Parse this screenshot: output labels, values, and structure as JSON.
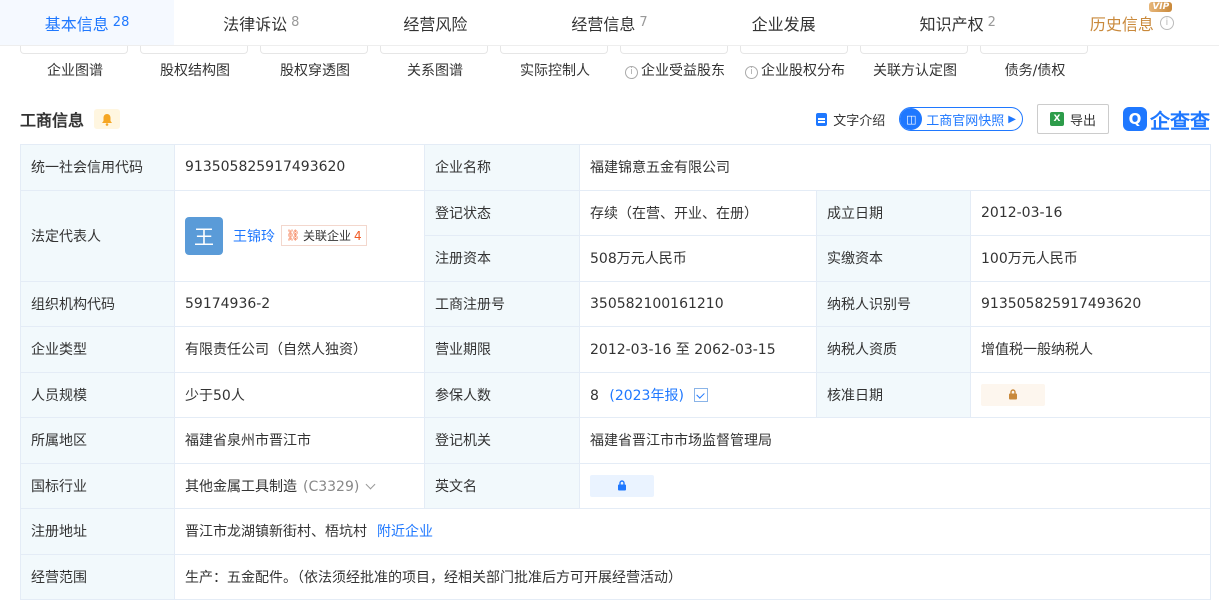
{
  "tabs": [
    {
      "label": "基本信息",
      "count": "28"
    },
    {
      "label": "法律诉讼",
      "count": "8"
    },
    {
      "label": "经营风险",
      "count": ""
    },
    {
      "label": "经营信息",
      "count": "7"
    },
    {
      "label": "企业发展",
      "count": ""
    },
    {
      "label": "知识产权",
      "count": "2"
    },
    {
      "label": "历史信息",
      "count": "",
      "badge": "VIP"
    }
  ],
  "graphs": [
    "企业图谱",
    "股权结构图",
    "股权穿透图",
    "关系图谱",
    "实际控制人",
    "企业受益股东",
    "企业股权分布",
    "关联方认定图",
    "债务/债权"
  ],
  "section": {
    "title": "工商信息",
    "text_intro": "文字介绍",
    "official_snapshot": "工商官网快照",
    "export": "导出",
    "logo": "企查查"
  },
  "colors": {
    "accent": "#1f78ff",
    "label_bg": "#f2f9fc",
    "border": "#e4ecf6",
    "history": "#c9893b"
  },
  "info": {
    "credit_code_label": "统一社会信用代码",
    "credit_code": "913505825917493620",
    "company_name_label": "企业名称",
    "company_name": "福建锦意五金有限公司",
    "legal_rep_label": "法定代表人",
    "legal_rep_avatar": "王",
    "legal_rep_name": "王锦玲",
    "related_label": "关联企业",
    "related_count": "4",
    "reg_status_label": "登记状态",
    "reg_status": "存续（在营、开业、在册）",
    "found_date_label": "成立日期",
    "found_date": "2012-03-16",
    "reg_capital_label": "注册资本",
    "reg_capital": "508万元人民币",
    "paid_capital_label": "实缴资本",
    "paid_capital": "100万元人民币",
    "org_code_label": "组织机构代码",
    "org_code": "59174936-2",
    "biz_reg_no_label": "工商注册号",
    "biz_reg_no": "350582100161210",
    "taxpayer_id_label": "纳税人识别号",
    "taxpayer_id": "913505825917493620",
    "company_type_label": "企业类型",
    "company_type": "有限责任公司（自然人独资）",
    "biz_term_label": "营业期限",
    "biz_term": "2012-03-16 至 2062-03-15",
    "tax_qual_label": "纳税人资质",
    "tax_qual": "增值税一般纳税人",
    "staff_size_label": "人员规模",
    "staff_size": "少于50人",
    "insured_label": "参保人数",
    "insured_count": "8",
    "insured_year": "(2023年报)",
    "approve_date_label": "核准日期",
    "region_label": "所属地区",
    "region": "福建省泉州市晋江市",
    "reg_authority_label": "登记机关",
    "reg_authority": "福建省晋江市市场监督管理局",
    "industry_label": "国标行业",
    "industry": "其他金属工具制造",
    "industry_code": "(C3329)",
    "english_name_label": "英文名",
    "address_label": "注册地址",
    "address": "晋江市龙湖镇新街村、梧坑村",
    "nearby_label": "附近企业",
    "scope_label": "经营范围",
    "scope": "生产：五金配件。（依法须经批准的项目，经相关部门批准后方可开展经营活动）"
  }
}
